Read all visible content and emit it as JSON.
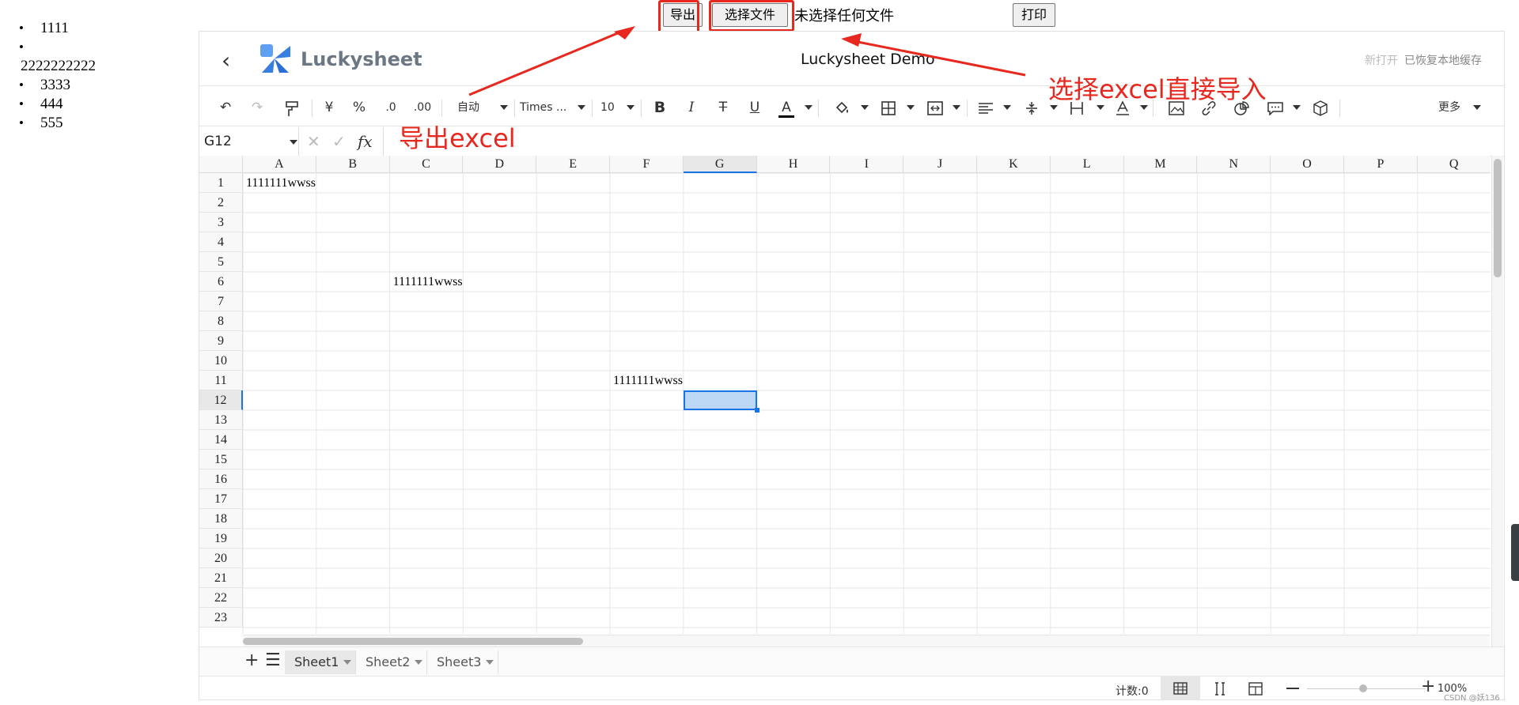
{
  "sidebar_list": [
    "1111",
    "2222222222",
    "3333",
    "444",
    "555"
  ],
  "top": {
    "export_label": "导出",
    "choose_file_label": "选择文件",
    "file_status": "未选择任何文件",
    "print_label": "打印"
  },
  "app": {
    "logo_text": "Luckysheet",
    "title": "Luckysheet Demo",
    "status_new": "新打开",
    "status_restore": "已恢复本地缓存"
  },
  "toolbar": {
    "undo": "↶",
    "redo": "↷",
    "paint": "⌫",
    "currency": "¥",
    "percent": "%",
    "dec_less": ".0",
    "dec_more": ".00",
    "format": "自动",
    "font": "Times ...",
    "size": "10",
    "bold": "B",
    "italic": "I",
    "strike": "T",
    "underline": "U",
    "textcolor": "A",
    "more": "更多"
  },
  "formula": {
    "cell": "G12",
    "fx": "fx"
  },
  "columns": [
    "A",
    "B",
    "C",
    "D",
    "E",
    "F",
    "G",
    "H",
    "I",
    "J",
    "K",
    "L",
    "M",
    "N",
    "O",
    "P",
    "Q"
  ],
  "rows": [
    "1",
    "2",
    "3",
    "4",
    "5",
    "6",
    "7",
    "8",
    "9",
    "10",
    "11",
    "12",
    "13",
    "14",
    "15",
    "16",
    "17",
    "18",
    "19",
    "20",
    "21",
    "22",
    "23"
  ],
  "cells": [
    {
      "ref": "A1",
      "value": "1111111wwss"
    },
    {
      "ref": "C6",
      "value": "1111111wwss"
    },
    {
      "ref": "F11",
      "value": "1111111wwss"
    }
  ],
  "sheets": [
    "Sheet1",
    "Sheet2",
    "Sheet3"
  ],
  "statusbar": {
    "count": "计数:0",
    "zoom": "100%",
    "watermark": "CSDN @妖136"
  },
  "annotations": {
    "export": "导出excel",
    "import": "选择excel直接导入"
  },
  "colors": {
    "accent": "#e8281e",
    "selection": "#bcd7f4",
    "selection_border": "#1a73e8"
  }
}
